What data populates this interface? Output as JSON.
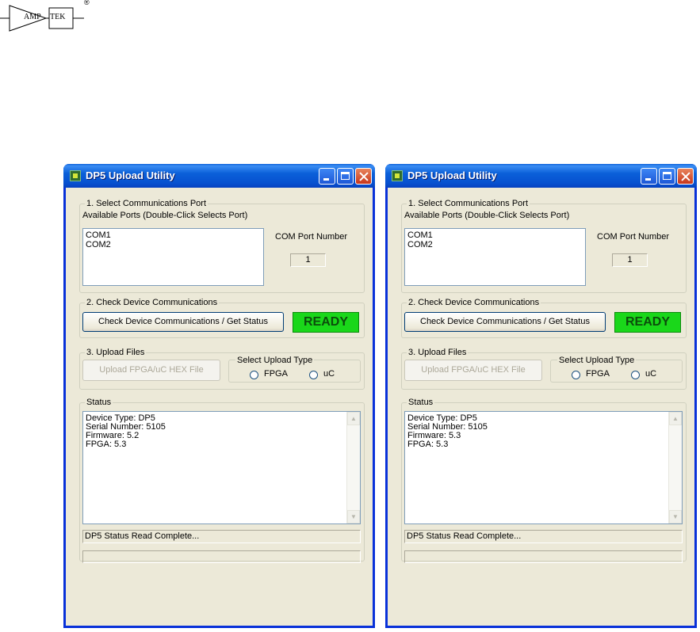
{
  "logo": {
    "left": "AMP",
    "right": "TEK",
    "registered": "®"
  },
  "windows": [
    {
      "title": "DP5 Upload Utility",
      "group1": {
        "label": "1. Select Communications Port",
        "ports_label": "Available Ports (Double-Click Selects Port)",
        "ports": [
          "COM1",
          "COM2"
        ],
        "com_port_label": "COM Port Number",
        "com_port_value": "1"
      },
      "group2": {
        "label": "2. Check Device Communications",
        "check_button": "Check Device Communications / Get Status",
        "ready": "READY"
      },
      "group3": {
        "label": "3. Upload Files",
        "upload_button": "Upload FPGA/uC HEX File",
        "upload_type_label": "Select Upload Type",
        "option_fpga": "FPGA",
        "option_uc": "uC"
      },
      "status": {
        "label": "Status",
        "lines": [
          "Device Type: DP5",
          "Serial Number: 5105",
          "Firmware: 5.2",
          "FPGA: 5.3"
        ]
      },
      "statusbar": "DP5 Status Read Complete..."
    },
    {
      "title": "DP5 Upload Utility",
      "group1": {
        "label": "1. Select Communications Port",
        "ports_label": "Available Ports (Double-Click Selects Port)",
        "ports": [
          "COM1",
          "COM2"
        ],
        "com_port_label": "COM Port Number",
        "com_port_value": "1"
      },
      "group2": {
        "label": "2. Check Device Communications",
        "check_button": "Check Device Communications / Get Status",
        "ready": "READY"
      },
      "group3": {
        "label": "3. Upload Files",
        "upload_button": "Upload FPGA/uC HEX File",
        "upload_type_label": "Select Upload Type",
        "option_fpga": "FPGA",
        "option_uc": "uC"
      },
      "status": {
        "label": "Status",
        "lines": [
          "Device Type: DP5",
          "Serial Number: 5105",
          "Firmware: 5.3",
          "FPGA: 5.3"
        ]
      },
      "statusbar": "DP5 Status Read Complete..."
    }
  ]
}
